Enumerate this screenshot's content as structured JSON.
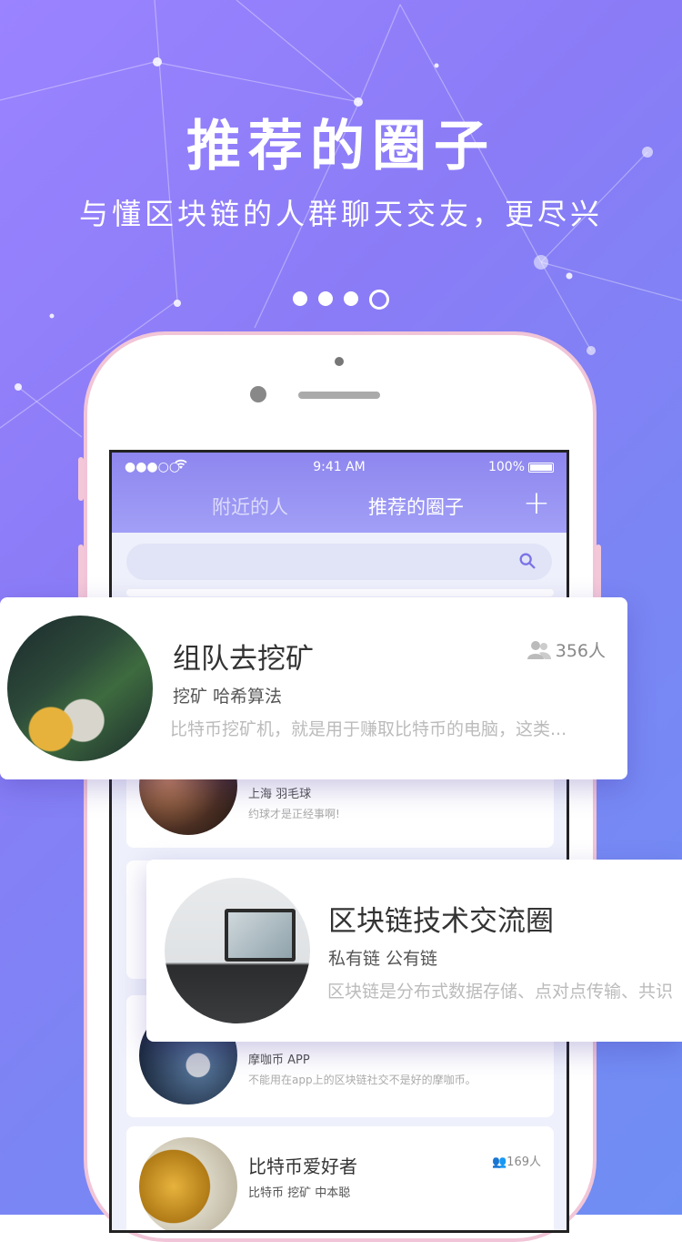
{
  "hero": {
    "title": "推荐的圈子",
    "subtitle": "与懂区块链的人群聊天交友，更尽兴"
  },
  "pagination": {
    "total": 4,
    "active_index": 3
  },
  "phone": {
    "status_bar": {
      "carrier": "●●●○○",
      "time": "9:41 AM",
      "battery": "100%"
    },
    "tabs": [
      {
        "label": "附近的人",
        "active": false
      },
      {
        "label": "推荐的圈子",
        "active": true
      }
    ],
    "add_icon": "plus-icon",
    "search_icon": "search-icon",
    "list": [
      {
        "tags": "上海  羽毛球",
        "desc": "约球才是正经事啊!"
      },
      {
        "tags": "摩咖币 APP",
        "desc": "不能用在app上的区块链社交不是好的摩咖币。"
      },
      {
        "title": "比特币爱好者",
        "tags": "比特币 挖矿 中本聪",
        "count": "169人"
      }
    ]
  },
  "featured": [
    {
      "title": "组队去挖矿",
      "tags": "挖矿  哈希算法",
      "desc": "比特币挖矿机，就是用于赚取比特币的电脑，这类...",
      "count": "356人"
    },
    {
      "title": "区块链技术交流圈",
      "tags": "私有链 公有链",
      "desc": "区块链是分布式数据存储、点对点传输、共识"
    }
  ],
  "colors": {
    "bg_start": "#9b83ff",
    "bg_end": "#6f8ef3",
    "accent": "#8e86ef",
    "phone_frame": "#f1c5d7"
  }
}
